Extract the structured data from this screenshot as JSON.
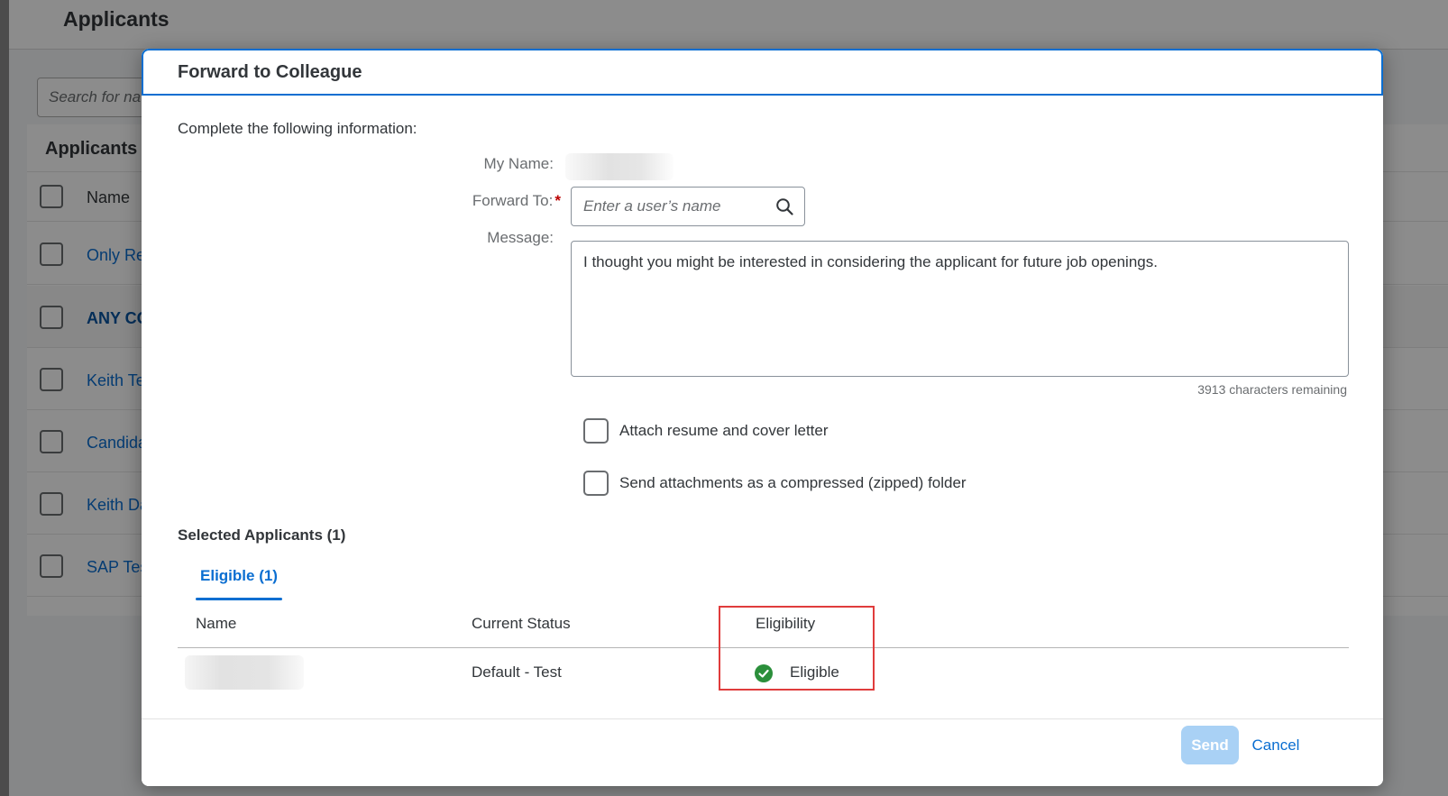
{
  "background": {
    "page_title": "Applicants",
    "search_placeholder": "Search for na",
    "list_title": "Applicants",
    "column_name": "Name",
    "rows": [
      "Only Re",
      "ANY CO",
      "Keith Te",
      "Candida",
      "Keith Da",
      "SAP Tes"
    ]
  },
  "dialog": {
    "title": "Forward to Colleague",
    "instructions": "Complete the following information:",
    "my_name_label": "My Name:",
    "forward_to_label": "Forward To:",
    "required_marker": "*",
    "forward_to_placeholder": "Enter a user’s name",
    "message_label": "Message:",
    "message_value": "I thought you might be interested in considering the applicant for future job openings.",
    "chars_remaining": "3913 characters remaining",
    "attach_resume_label": "Attach resume and cover letter",
    "zip_label": "Send attachments as a compressed (zipped) folder",
    "selected_applicants_title": "Selected Applicants (1)",
    "tabs": [
      {
        "label": "Eligible (1)"
      }
    ],
    "table": {
      "headers": [
        "Name",
        "Current Status",
        "Eligibility"
      ],
      "rows": [
        {
          "status": "Default - Test",
          "eligibility": "Eligible"
        }
      ]
    },
    "footer": {
      "send_label": "Send",
      "cancel_label": "Cancel"
    }
  },
  "colors": {
    "accent": "#0a6ed1",
    "eligible_green": "#2b8f3b",
    "highlight_red": "#e03c3c",
    "send_disabled": "#a9d1f5"
  }
}
